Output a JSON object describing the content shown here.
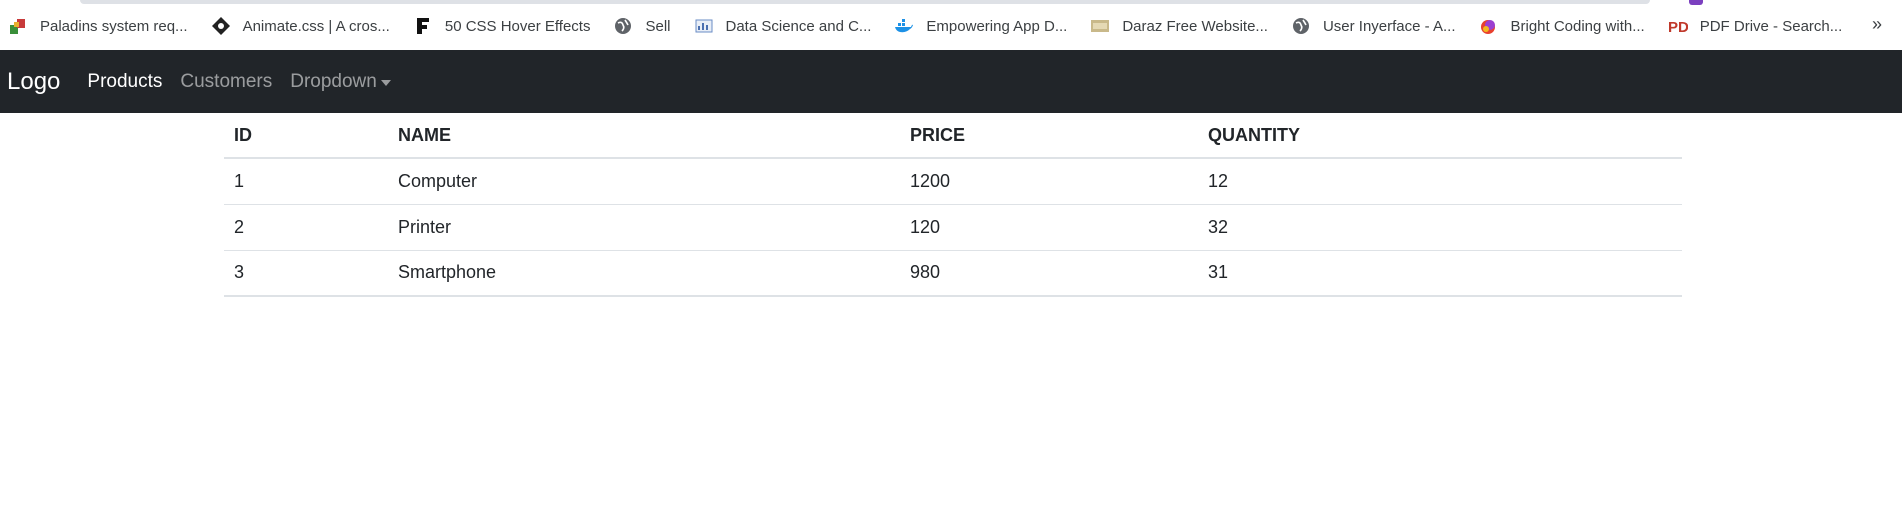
{
  "bookmarks": [
    {
      "label": "Paladins system req...",
      "icon": "paladins-icon"
    },
    {
      "label": "Animate.css | A cros...",
      "icon": "animate-css-icon"
    },
    {
      "label": "50 CSS Hover Effects",
      "icon": "f-logo-icon"
    },
    {
      "label": "Sell",
      "icon": "globe-icon"
    },
    {
      "label": "Data Science and C...",
      "icon": "data-science-icon"
    },
    {
      "label": "Empowering App D...",
      "icon": "docker-whale-icon"
    },
    {
      "label": "Daraz Free Website...",
      "icon": "css-badge-icon"
    },
    {
      "label": "User Inyerface - A...",
      "icon": "globe-icon"
    },
    {
      "label": "Bright Coding with...",
      "icon": "bright-coding-icon"
    },
    {
      "label": "PDF Drive - Search...",
      "icon": "pdf-drive-icon"
    }
  ],
  "bookmarks_more": "»",
  "navbar": {
    "brand": "Logo",
    "links": [
      "Products",
      "Customers",
      "Dropdown"
    ]
  },
  "table": {
    "headers": [
      "ID",
      "NAME",
      "PRICE",
      "QUANTITY"
    ],
    "rows": [
      [
        "1",
        "Computer",
        "1200",
        "12"
      ],
      [
        "2",
        "Printer",
        "120",
        "32"
      ],
      [
        "3",
        "Smartphone",
        "980",
        "31"
      ]
    ]
  },
  "colors": {
    "navbar_bg": "#212529",
    "nav_active": "#ffffff",
    "nav_muted": "#8c8f91"
  }
}
